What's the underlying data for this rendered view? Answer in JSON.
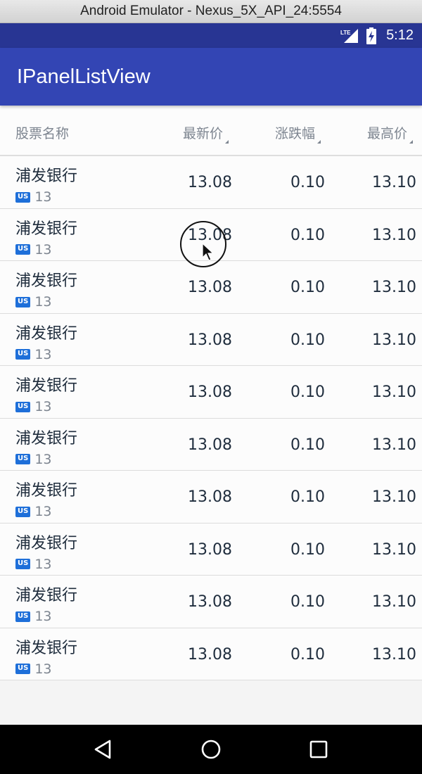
{
  "window": {
    "title": "Android Emulator - Nexus_5X_API_24:5554"
  },
  "status_bar": {
    "network": "LTE",
    "time": "5:12"
  },
  "app_bar": {
    "title": "IPanelListView"
  },
  "table": {
    "headers": {
      "name": "股票名称",
      "price": "最新价",
      "change": "涨跌幅",
      "high": "最高价"
    },
    "rows": [
      {
        "name": "浦发银行",
        "market": "US",
        "code": "13",
        "price": "13.08",
        "change": "0.10",
        "high": "13.10"
      },
      {
        "name": "浦发银行",
        "market": "US",
        "code": "13",
        "price": "13.08",
        "change": "0.10",
        "high": "13.10"
      },
      {
        "name": "浦发银行",
        "market": "US",
        "code": "13",
        "price": "13.08",
        "change": "0.10",
        "high": "13.10"
      },
      {
        "name": "浦发银行",
        "market": "US",
        "code": "13",
        "price": "13.08",
        "change": "0.10",
        "high": "13.10"
      },
      {
        "name": "浦发银行",
        "market": "US",
        "code": "13",
        "price": "13.08",
        "change": "0.10",
        "high": "13.10"
      },
      {
        "name": "浦发银行",
        "market": "US",
        "code": "13",
        "price": "13.08",
        "change": "0.10",
        "high": "13.10"
      },
      {
        "name": "浦发银行",
        "market": "US",
        "code": "13",
        "price": "13.08",
        "change": "0.10",
        "high": "13.10"
      },
      {
        "name": "浦发银行",
        "market": "US",
        "code": "13",
        "price": "13.08",
        "change": "0.10",
        "high": "13.10"
      },
      {
        "name": "浦发银行",
        "market": "US",
        "code": "13",
        "price": "13.08",
        "change": "0.10",
        "high": "13.10"
      },
      {
        "name": "浦发银行",
        "market": "US",
        "code": "13",
        "price": "13.08",
        "change": "0.10",
        "high": "13.10"
      }
    ]
  },
  "icons": {
    "signal": "signal-icon",
    "battery": "battery-charging-icon",
    "back": "back-triangle-icon",
    "home": "home-circle-icon",
    "recents": "recents-square-icon"
  },
  "colors": {
    "status_bar": "#283593",
    "app_bar": "#3345b4",
    "badge": "#1e6fd9",
    "text_primary": "#1f2d3d",
    "text_secondary": "#7d8590"
  }
}
